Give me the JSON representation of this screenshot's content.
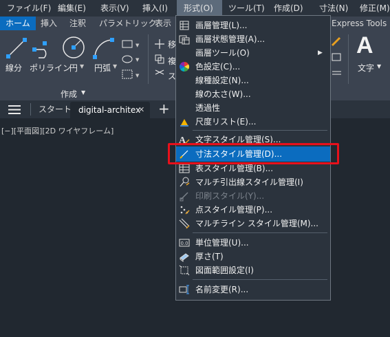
{
  "menubar": {
    "items": [
      "ファイル(F)",
      "編集(E)",
      "表示(V)",
      "挿入(I)",
      "形式(O)",
      "ツール(T)",
      "作成(D)",
      "寸法(N)",
      "修正(M)"
    ],
    "active_index": 4
  },
  "ribbon_tabs": {
    "items": [
      "ホーム",
      "挿入",
      "注釈",
      "パラメトリック",
      "表示"
    ],
    "right_tab": "Express Tools",
    "active_index": 0
  },
  "ribbon": {
    "draw_tools": [
      "線分",
      "ポリライン",
      "円",
      "円弧"
    ],
    "modify_tools": [
      "移",
      "複",
      "ス"
    ],
    "panel_label": "作成",
    "text_tool": "文字",
    "text_glyph": "A"
  },
  "file_tabs": {
    "start": "スタート",
    "current": "digital-architex",
    "close_glyph": "✕",
    "add_glyph": "+"
  },
  "viewport": {
    "label": "[−][平面図][2D ワイヤフレーム]"
  },
  "format_menu": {
    "items": [
      {
        "label": "画層管理(L)...",
        "icon": "layer-manager-icon"
      },
      {
        "label": "画層状態管理(A)...",
        "icon": "layer-states-icon"
      },
      {
        "label": "画層ツール(O)",
        "icon": "",
        "submenu": true
      },
      {
        "label": "色設定(C)...",
        "icon": "color-wheel-icon"
      },
      {
        "label": "線種設定(N)...",
        "icon": ""
      },
      {
        "label": "線の太さ(W)...",
        "icon": ""
      },
      {
        "label": "透過性",
        "icon": ""
      },
      {
        "label": "尺度リスト(E)...",
        "icon": "scale-list-icon"
      },
      {
        "label": "文字スタイル管理(S)...",
        "icon": "text-style-icon"
      },
      {
        "label": "寸法スタイル管理(D)...",
        "icon": "dimension-style-icon",
        "highlighted": true
      },
      {
        "label": "表スタイル管理(B)...",
        "icon": "table-style-icon"
      },
      {
        "label": "マルチ引出線スタイル管理(I)",
        "icon": "multileader-style-icon"
      },
      {
        "label": "印刷スタイル(Y)...",
        "icon": "plot-style-icon",
        "disabled": true
      },
      {
        "label": "点スタイル管理(P)...",
        "icon": "point-style-icon"
      },
      {
        "label": "マルチライン スタイル管理(M)...",
        "icon": "multiline-style-icon"
      },
      {
        "label": "単位管理(U)...",
        "icon": "units-icon"
      },
      {
        "label": "厚さ(T)",
        "icon": "thickness-icon"
      },
      {
        "label": "図面範囲設定(I)",
        "icon": "drawing-limits-icon"
      },
      {
        "label": "名前変更(R)...",
        "icon": "rename-icon"
      }
    ]
  },
  "colors": {
    "accent": "#0b6cbf",
    "annotation_red": "#e8101b"
  }
}
